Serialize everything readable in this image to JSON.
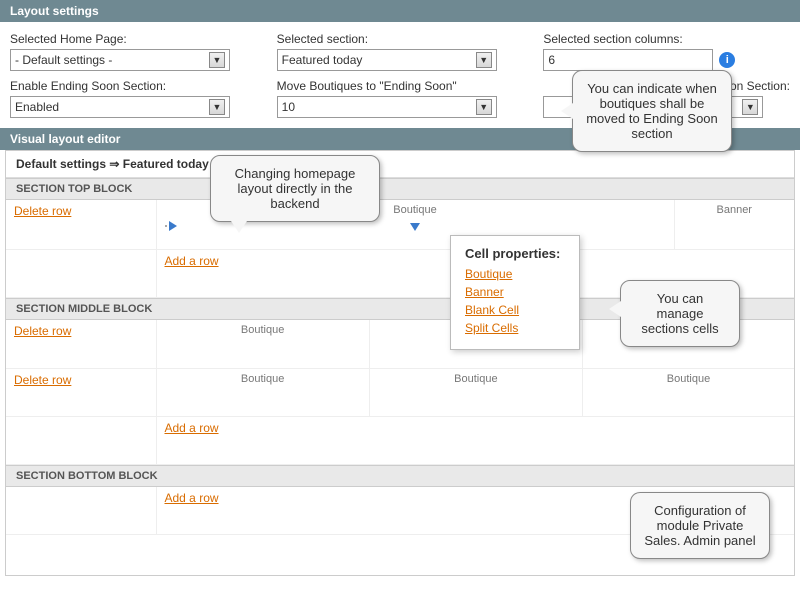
{
  "layout_panel": {
    "title": "Layout settings",
    "fields": {
      "home_page": {
        "label": "Selected Home Page:",
        "value": "- Default settings -"
      },
      "section": {
        "label": "Selected section:",
        "value": "Featured today"
      },
      "columns": {
        "label": "Selected section columns:",
        "value": "6"
      },
      "ending_enable": {
        "label": "Enable Ending Soon Section:",
        "value": "Enabled"
      },
      "move_ending": {
        "label": "Move Boutiques to \"Ending Soon\"",
        "value": "10"
      },
      "coming_section": {
        "label": "ing Soon Section:",
        "value": ""
      }
    }
  },
  "editor_panel": {
    "title": "Visual layout editor",
    "breadcrumb_left": "Default settings",
    "breadcrumb_sep": "⇒",
    "breadcrumb_right": "Featured today",
    "sections": {
      "top": "SECTION TOP BLOCK",
      "middle": "SECTION MIDDLE BLOCK",
      "bottom": "SECTION BOTTOM BLOCK"
    },
    "actions": {
      "delete_row": "Delete row",
      "add_row": "Add a row"
    },
    "cell_labels": {
      "boutique": "Boutique",
      "banner": "Banner"
    },
    "popup": {
      "title": "Cell properties:",
      "items": [
        "Boutique",
        "Banner",
        "Blank Cell",
        "Split Cells"
      ]
    }
  },
  "callouts": {
    "c1": "Changing homepage layout directly in the backend",
    "c2": "You can indicate when boutiques shall be moved to Ending Soon section",
    "c3": "You can manage sections cells",
    "c4": "Configuration of module Private Sales. Admin panel"
  }
}
